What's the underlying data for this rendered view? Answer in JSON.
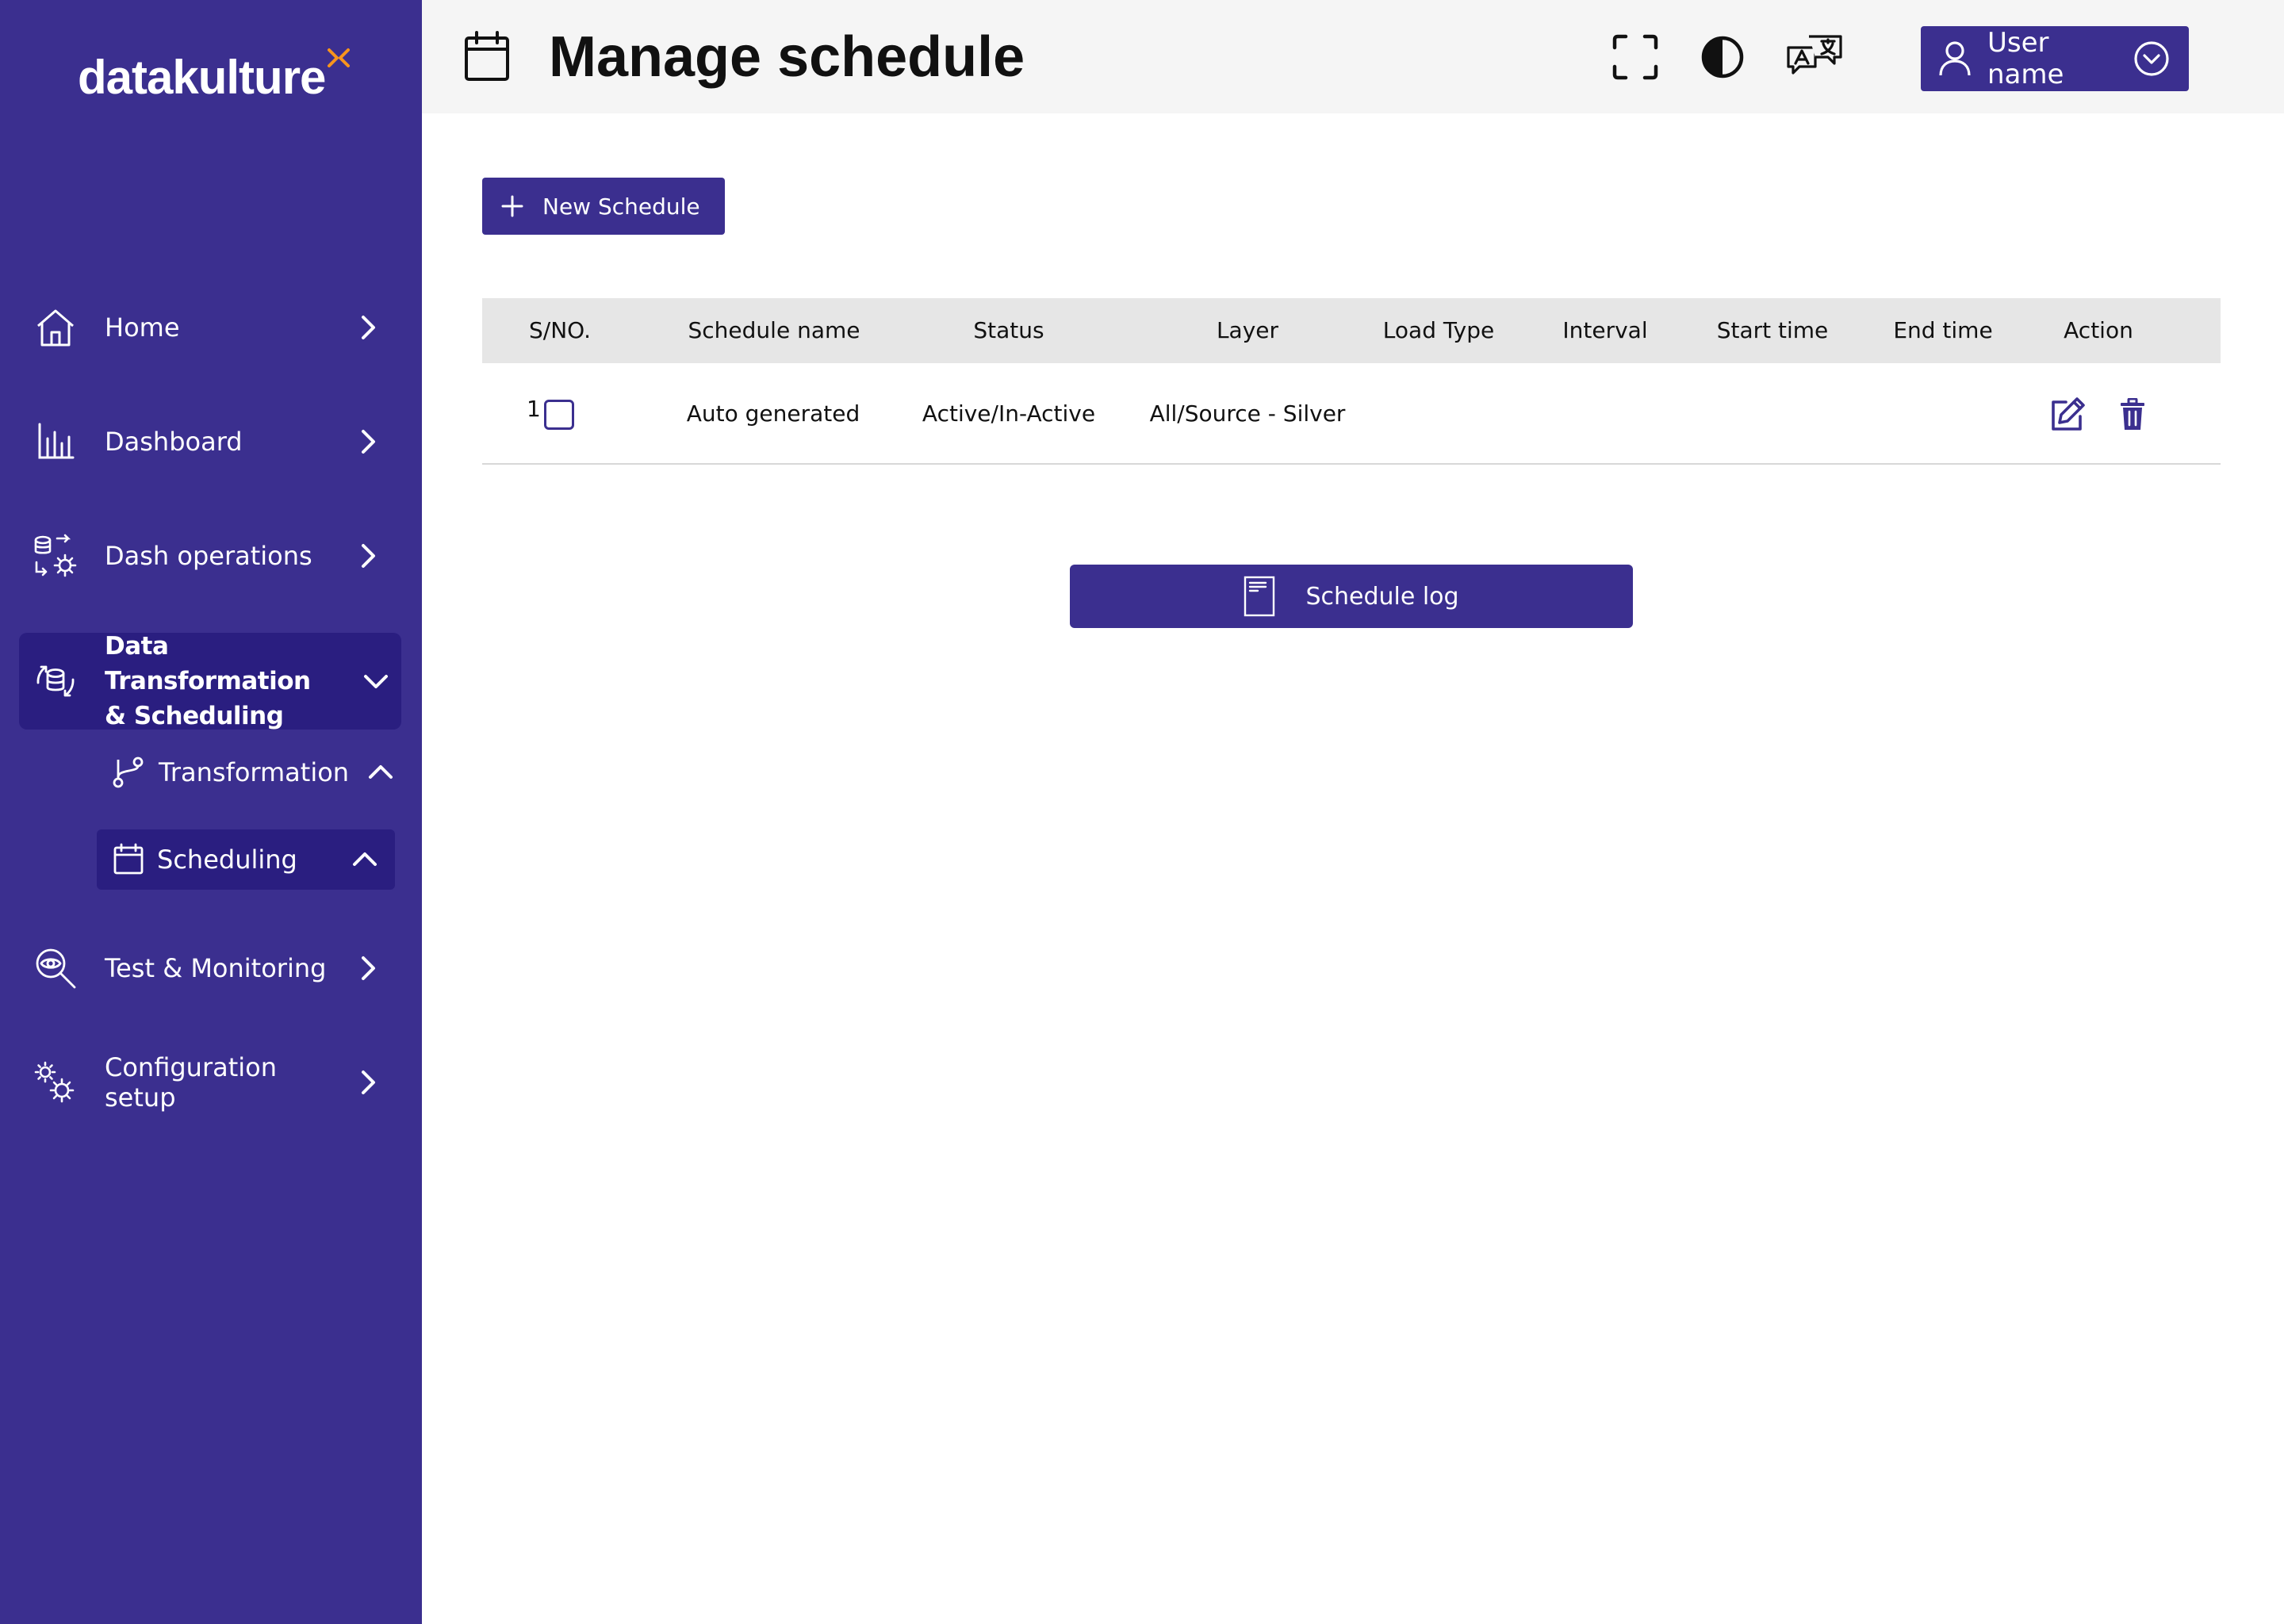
{
  "brand": {
    "name": "datakulture",
    "accent": "#f7941d"
  },
  "colors": {
    "primary": "#3b2f8f",
    "primary_dark": "#2a1e80",
    "header_bg": "#f5f5f5",
    "table_header_bg": "#e6e6e6"
  },
  "sidebar": {
    "items": [
      {
        "label": "Home",
        "icon": "home-icon"
      },
      {
        "label": "Dashboard",
        "icon": "bar-chart-icon"
      },
      {
        "label": "Dash operations",
        "icon": "database-gear-icon"
      },
      {
        "label_line1": "Data Transformation",
        "label_line2": "& Scheduling",
        "icon": "data-sync-icon",
        "expanded": true
      },
      {
        "label": "Test & Monitoring",
        "icon": "magnifier-eye-icon"
      },
      {
        "label": "Configuration setup",
        "icon": "gears-icon"
      }
    ],
    "subitems": [
      {
        "label": "Transformation",
        "icon": "git-branch-icon"
      },
      {
        "label": "Scheduling",
        "icon": "calendar-icon",
        "active": true
      }
    ]
  },
  "header": {
    "title": "Manage schedule",
    "icons": [
      "fullscreen-icon",
      "contrast-icon",
      "translate-icon"
    ],
    "user_label": "User name"
  },
  "toolbar": {
    "new_schedule_label": "New Schedule"
  },
  "table": {
    "columns": [
      "S/NO.",
      "Schedule name",
      "Status",
      "Layer",
      "Load Type",
      "Interval",
      "Start time",
      "End time",
      "Action"
    ],
    "rows": [
      {
        "sno": "1",
        "schedule_name": "Auto generated",
        "status": "Active/In-Active",
        "layer": "All/Source - Silver",
        "load_type": "",
        "interval": "",
        "start_time": "",
        "end_time": ""
      }
    ]
  },
  "footer": {
    "schedule_log_label": "Schedule log"
  }
}
